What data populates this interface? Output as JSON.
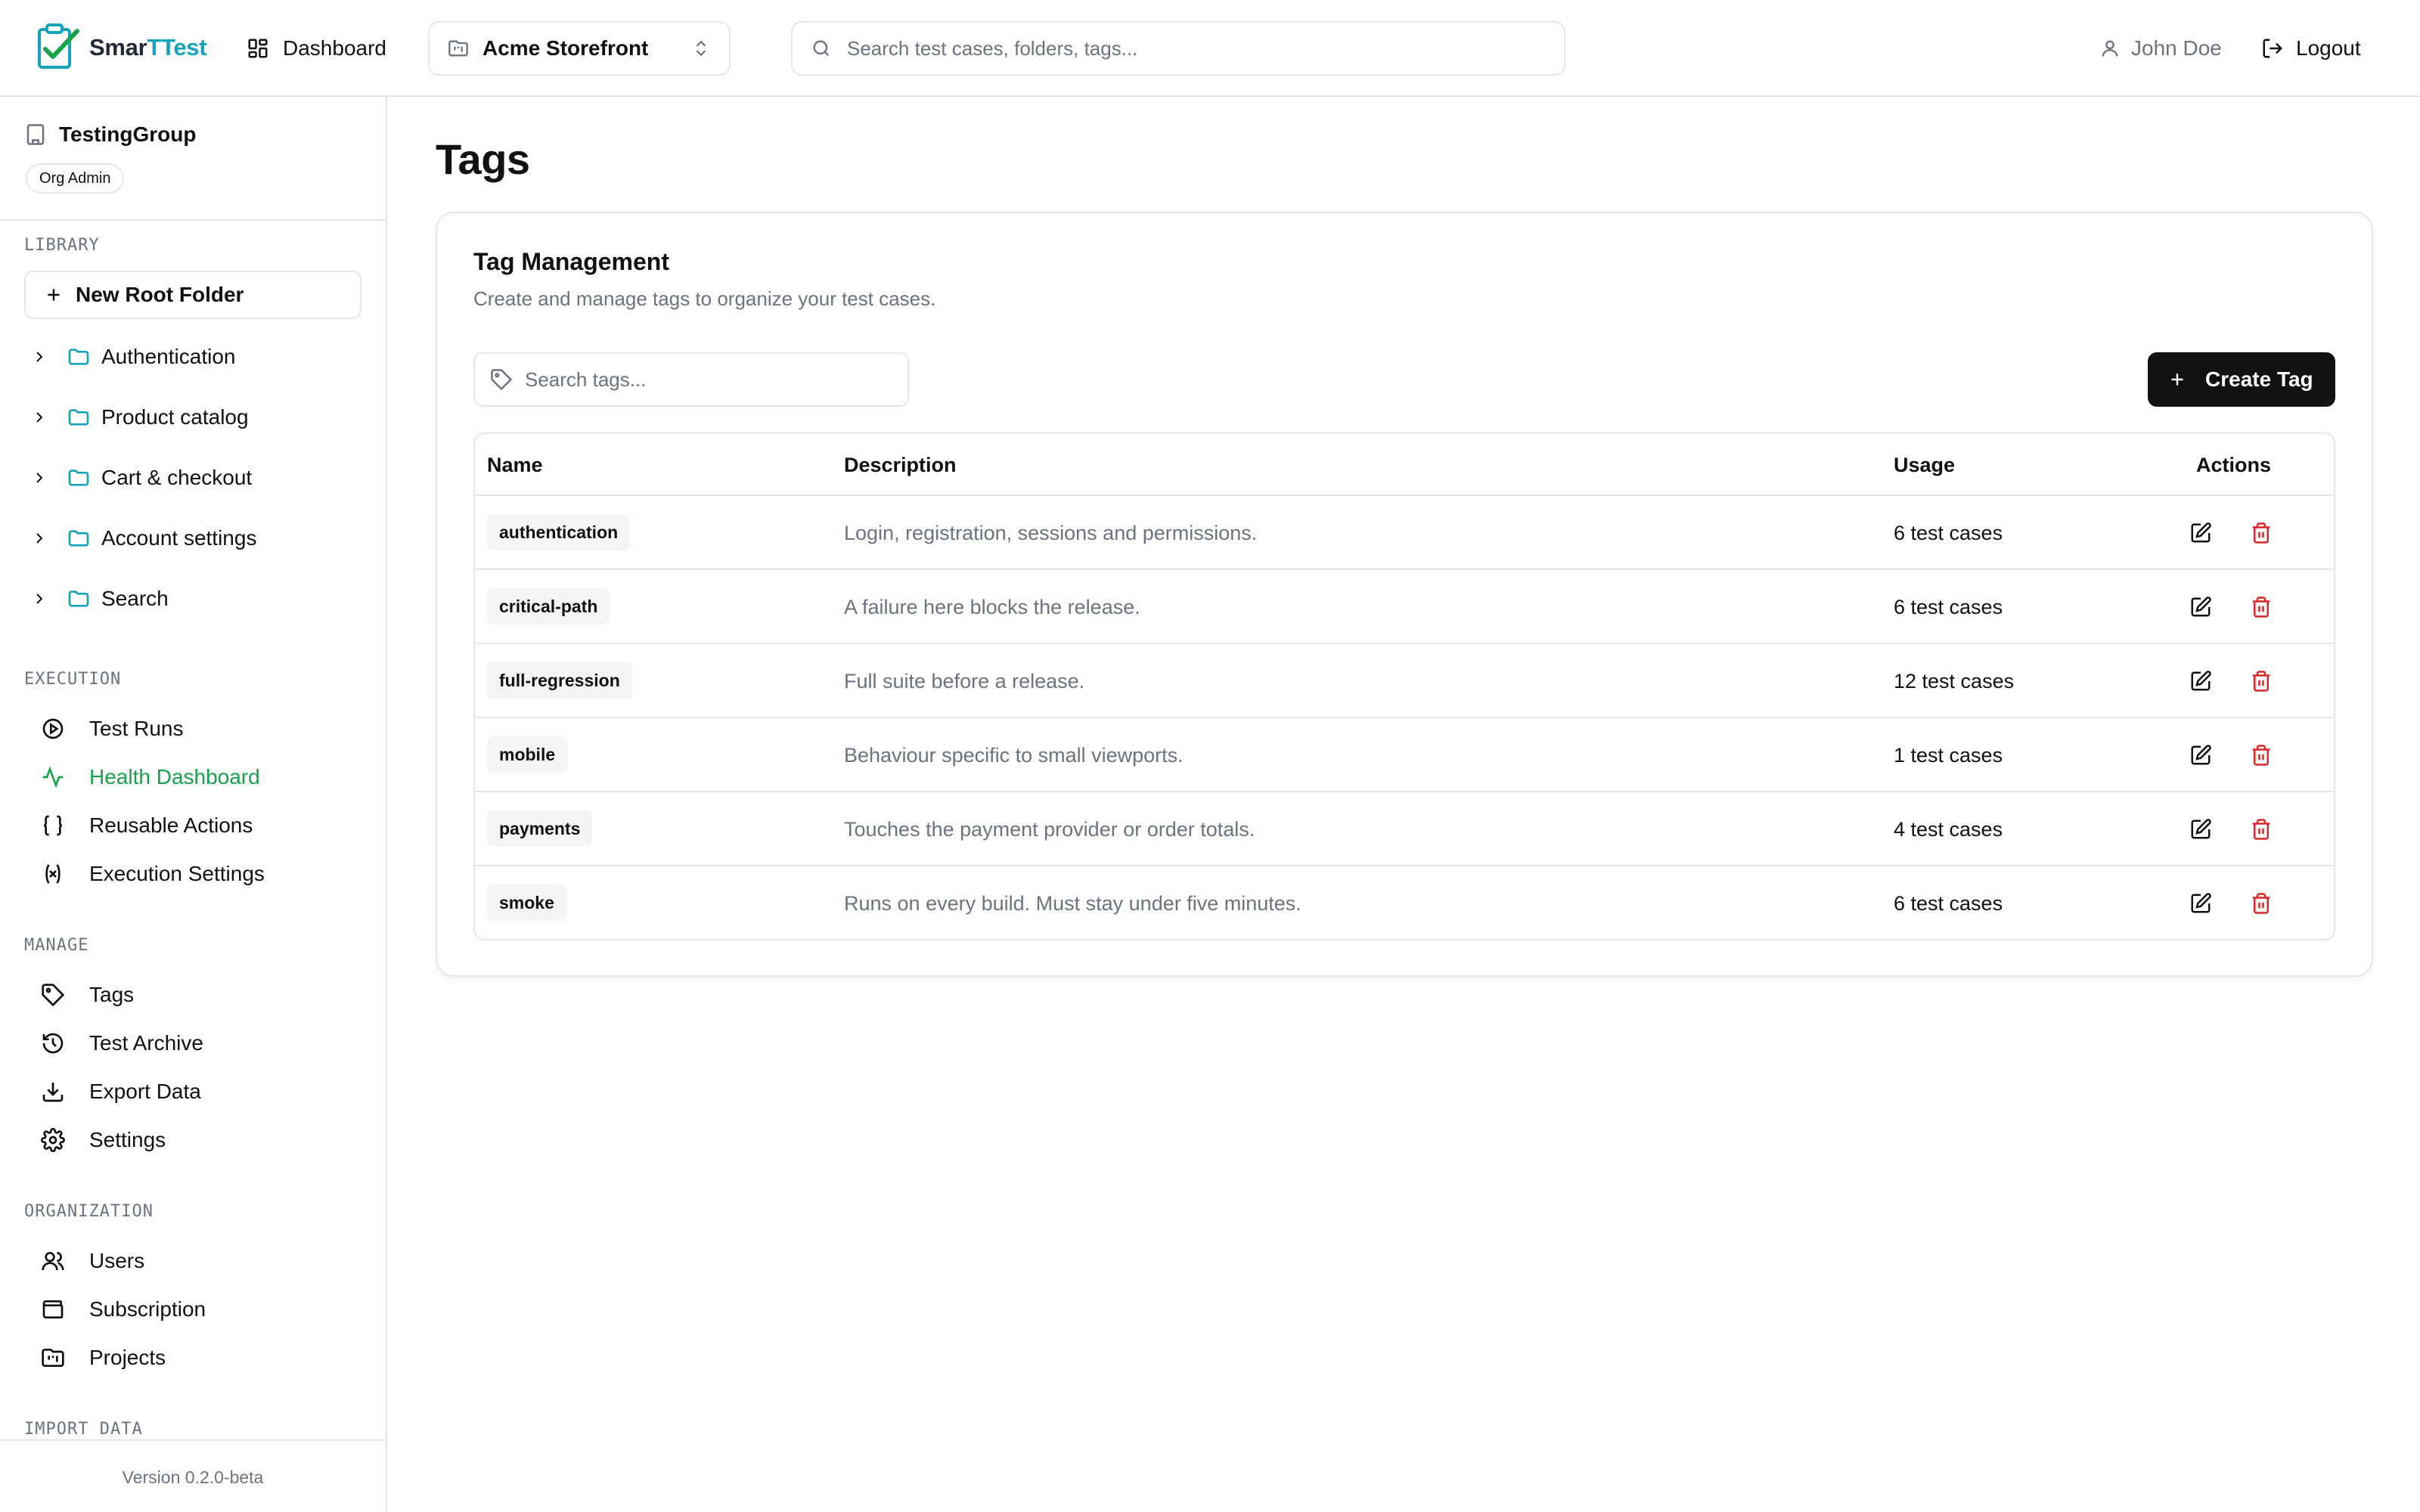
{
  "header": {
    "logo": {
      "text_a": "Smar",
      "text_b": "TTest"
    },
    "dashboard_label": "Dashboard",
    "project_selector": {
      "selected": "Acme Storefront"
    },
    "search": {
      "placeholder": "Search test cases, folders, tags..."
    },
    "user_name": "John Doe",
    "logout_label": "Logout"
  },
  "sidebar": {
    "org_name": "TestingGroup",
    "org_role": "Org Admin",
    "library_title": "LIBRARY",
    "new_root_folder_label": "New Root Folder",
    "folders": [
      {
        "label": "Authentication"
      },
      {
        "label": "Product catalog"
      },
      {
        "label": "Cart & checkout"
      },
      {
        "label": "Account settings"
      },
      {
        "label": "Search"
      }
    ],
    "execution_title": "EXECUTION",
    "execution_items": [
      {
        "label": "Test Runs",
        "icon": "play-circle-icon"
      },
      {
        "label": "Health Dashboard",
        "icon": "activity-icon"
      },
      {
        "label": "Reusable Actions",
        "icon": "braces-icon"
      },
      {
        "label": "Execution Settings",
        "icon": "variable-icon"
      }
    ],
    "manage_title": "MANAGE",
    "manage_items": [
      {
        "label": "Tags",
        "icon": "tag-icon"
      },
      {
        "label": "Test Archive",
        "icon": "history-icon"
      },
      {
        "label": "Export Data",
        "icon": "download-icon"
      },
      {
        "label": "Settings",
        "icon": "gear-icon"
      }
    ],
    "organization_title": "ORGANIZATION",
    "organization_items": [
      {
        "label": "Users",
        "icon": "users-icon"
      },
      {
        "label": "Subscription",
        "icon": "wallet-icon"
      },
      {
        "label": "Projects",
        "icon": "projects-icon"
      }
    ],
    "import_title": "IMPORT DATA",
    "version": "Version 0.2.0-beta",
    "active_item": "Health Dashboard"
  },
  "main": {
    "page_title": "Tags",
    "card_title": "Tag Management",
    "card_description": "Create and manage tags to organize your test cases.",
    "tag_search_placeholder": "Search tags...",
    "create_button_label": "Create Tag",
    "table": {
      "columns": [
        "Name",
        "Description",
        "Usage",
        "Actions"
      ],
      "rows": [
        {
          "name": "authentication",
          "description": "Login, registration, sessions and permissions.",
          "usage": "6 test cases"
        },
        {
          "name": "critical-path",
          "description": "A failure here blocks the release.",
          "usage": "6 test cases"
        },
        {
          "name": "full-regression",
          "description": "Full suite before a release.",
          "usage": "12 test cases"
        },
        {
          "name": "mobile",
          "description": "Behaviour specific to small viewports.",
          "usage": "1 test cases"
        },
        {
          "name": "payments",
          "description": "Touches the payment provider or order totals.",
          "usage": "4 test cases"
        },
        {
          "name": "smoke",
          "description": "Runs on every build. Must stay under five minutes.",
          "usage": "6 test cases"
        }
      ]
    }
  },
  "colors": {
    "accent_green": "#16a34a",
    "logo_teal": "#14a3b8",
    "danger_red": "#dc2626",
    "primary_button": "#111111"
  }
}
